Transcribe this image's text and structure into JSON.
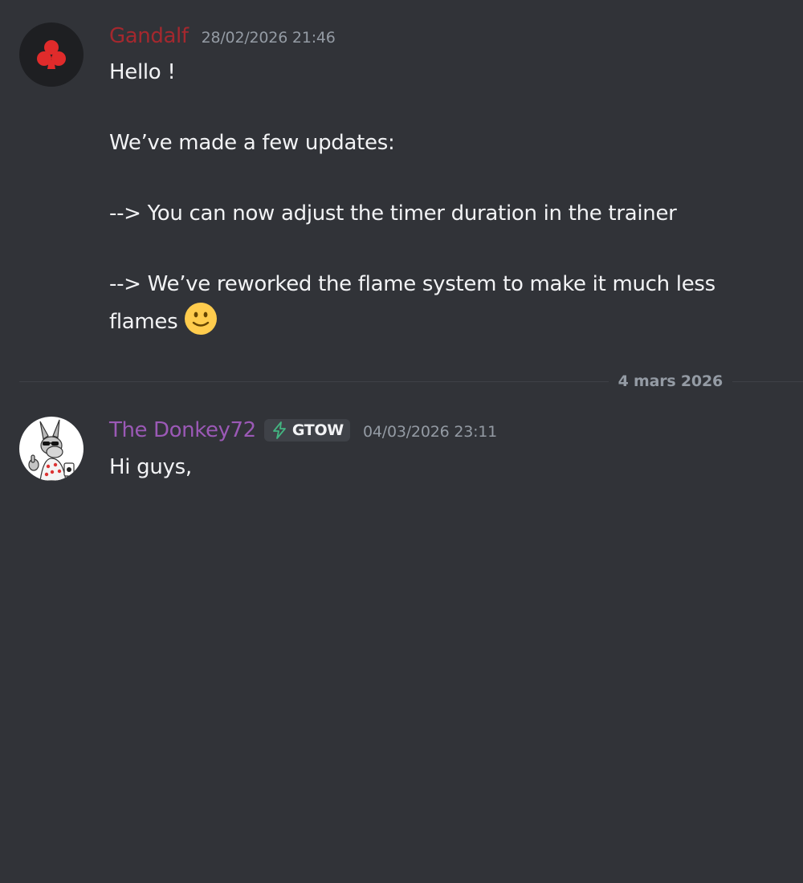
{
  "colors": {
    "background": "#313338",
    "gandalf_name": "#a4282e",
    "donkey_name": "#9b59b6",
    "timestamp": "#949ba4",
    "text": "#f2f3f5",
    "role_icon": "#43b581"
  },
  "messages": [
    {
      "author": "Gandalf",
      "avatar_icon": "club-suit-logo-icon",
      "timestamp": "28/02/2026 21:46",
      "lines": [
        "Hello !",
        "",
        "We’ve made a few updates:",
        "",
        "--> You can now adjust the timer duration in the trainer",
        "",
        "--> We’ve reworked the flame system to make it much less",
        "flames"
      ],
      "trailing_emoji": "slightly-smiling-face-emoji"
    },
    {
      "author": "The Donkey72",
      "avatar_icon": "donkey-cartoon-avatar-icon",
      "role_tag": {
        "icon": "lightning-bolt-icon",
        "label": "GTOW"
      },
      "timestamp": "04/03/2026 23:11",
      "lines": [
        "Hi guys,"
      ]
    }
  ],
  "date_divider": {
    "label": "4 mars 2026"
  }
}
